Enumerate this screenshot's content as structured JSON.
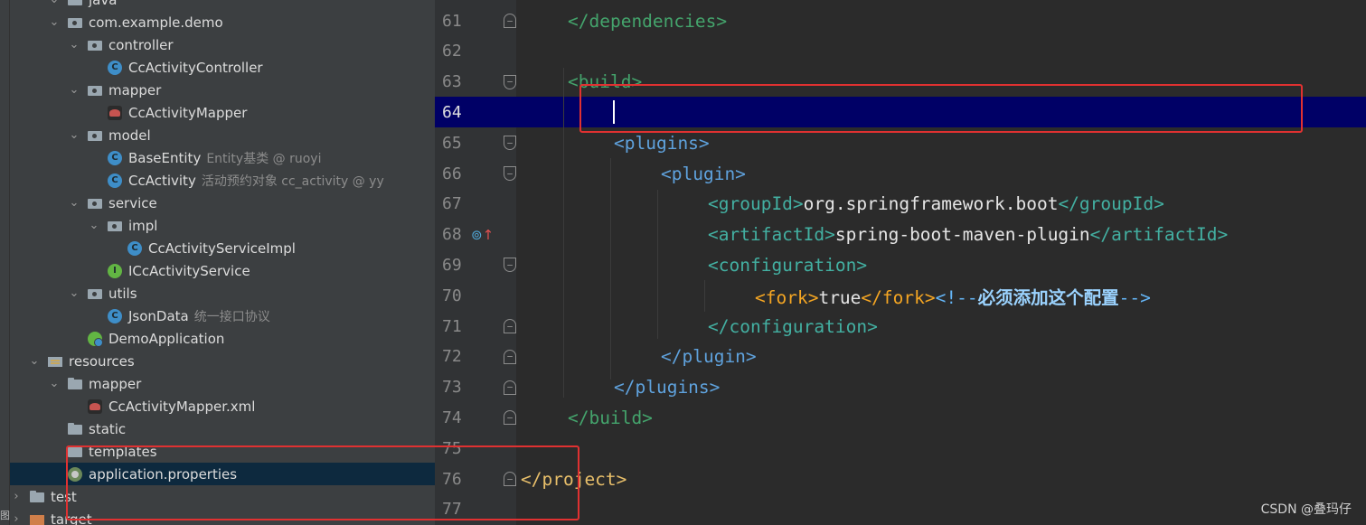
{
  "project_tree": {
    "items": [
      {
        "label": "java",
        "hint": "",
        "arrow": "open",
        "icon": "folder-icon"
      },
      {
        "label": "com.example.demo",
        "hint": "",
        "arrow": "open",
        "icon": "package-icon"
      },
      {
        "label": "controller",
        "hint": "",
        "arrow": "open",
        "icon": "package-icon"
      },
      {
        "label": "CcActivityController",
        "hint": "",
        "arrow": "none",
        "icon": "class-icon"
      },
      {
        "label": "mapper",
        "hint": "",
        "arrow": "open",
        "icon": "package-icon"
      },
      {
        "label": "CcActivityMapper",
        "hint": "",
        "arrow": "none",
        "icon": "mybatis-icon"
      },
      {
        "label": "model",
        "hint": "",
        "arrow": "open",
        "icon": "package-icon"
      },
      {
        "label": "BaseEntity",
        "hint": "Entity基类 @ ruoyi",
        "arrow": "none",
        "icon": "class-icon"
      },
      {
        "label": "CcActivity",
        "hint": "活动预约对象 cc_activity @ yy",
        "arrow": "none",
        "icon": "class-icon"
      },
      {
        "label": "service",
        "hint": "",
        "arrow": "open",
        "icon": "package-icon"
      },
      {
        "label": "impl",
        "hint": "",
        "arrow": "open",
        "icon": "package-icon"
      },
      {
        "label": "CcActivityServiceImpl",
        "hint": "",
        "arrow": "none",
        "icon": "class-icon"
      },
      {
        "label": "ICcActivityService",
        "hint": "",
        "arrow": "none",
        "icon": "interface-icon"
      },
      {
        "label": "utils",
        "hint": "",
        "arrow": "open",
        "icon": "package-icon"
      },
      {
        "label": "JsonData",
        "hint": "统一接口协议",
        "arrow": "none",
        "icon": "class-icon"
      },
      {
        "label": "DemoApplication",
        "hint": "",
        "arrow": "none",
        "icon": "spring-boot-icon"
      },
      {
        "label": "resources",
        "hint": "",
        "arrow": "open",
        "icon": "resources-folder-icon"
      },
      {
        "label": "mapper",
        "hint": "",
        "arrow": "open",
        "icon": "folder-icon"
      },
      {
        "label": "CcActivityMapper.xml",
        "hint": "",
        "arrow": "none",
        "icon": "mybatis-icon"
      },
      {
        "label": "static",
        "hint": "",
        "arrow": "none",
        "icon": "folder-icon"
      },
      {
        "label": "templates",
        "hint": "",
        "arrow": "none",
        "icon": "folder-icon"
      },
      {
        "label": "application.properties",
        "hint": "",
        "arrow": "none",
        "icon": "properties-icon"
      },
      {
        "label": "test",
        "hint": "",
        "arrow": "closed",
        "icon": "folder-icon"
      },
      {
        "label": "target",
        "hint": "",
        "arrow": "closed",
        "icon": "orange-folder-icon"
      }
    ],
    "selected_index": 21,
    "side_strip_glyph": "图"
  },
  "editor": {
    "current_line": "64",
    "lines": [
      {
        "n": "61",
        "tokens": [
          {
            "t": "</dependencies>",
            "c": "t-dim"
          }
        ]
      },
      {
        "n": "62",
        "tokens": []
      },
      {
        "n": "63",
        "tokens": [
          {
            "t": "<build>",
            "c": "t-dim"
          }
        ]
      },
      {
        "n": "64",
        "tokens": []
      },
      {
        "n": "65",
        "tokens": [
          {
            "t": "<plugins>",
            "c": "t-plug"
          }
        ]
      },
      {
        "n": "66",
        "tokens": [
          {
            "t": "<plugin>",
            "c": "t-plug"
          }
        ]
      },
      {
        "n": "67",
        "tokens": [
          {
            "t": "<groupId>",
            "c": "t-cfg"
          },
          {
            "t": "org.springframework.boot",
            "c": "t-txt"
          },
          {
            "t": "</groupId>",
            "c": "t-cfg"
          }
        ]
      },
      {
        "n": "68",
        "tokens": [
          {
            "t": "<artifactId>",
            "c": "t-cfg"
          },
          {
            "t": "spring-boot-maven-plugin",
            "c": "t-txt"
          },
          {
            "t": "</artifactId>",
            "c": "t-cfg"
          }
        ]
      },
      {
        "n": "69",
        "tokens": [
          {
            "t": "<configuration>",
            "c": "t-cfg"
          }
        ]
      },
      {
        "n": "70",
        "tokens": [
          {
            "t": "<fork>",
            "c": "t-fork"
          },
          {
            "t": "true",
            "c": "t-txt"
          },
          {
            "t": "</fork>",
            "c": "t-fork"
          },
          {
            "t": "<!--",
            "c": "t-cmt"
          },
          {
            "t": "必须添加这个配置",
            "c": "t-cmt-cn"
          },
          {
            "t": "-->",
            "c": "t-cmt"
          }
        ]
      },
      {
        "n": "71",
        "tokens": [
          {
            "t": "</configuration>",
            "c": "t-cfg"
          }
        ]
      },
      {
        "n": "72",
        "tokens": [
          {
            "t": "</plugin>",
            "c": "t-plug"
          }
        ]
      },
      {
        "n": "73",
        "tokens": [
          {
            "t": "</plugins>",
            "c": "t-plug"
          }
        ]
      },
      {
        "n": "74",
        "tokens": [
          {
            "t": "</build>",
            "c": "t-dim"
          }
        ]
      },
      {
        "n": "75",
        "tokens": []
      },
      {
        "n": "76",
        "tokens": [
          {
            "t": "</project>",
            "c": "t-tag"
          }
        ]
      },
      {
        "n": "77",
        "tokens": []
      }
    ]
  },
  "watermark": "CSDN @叠玛仔"
}
